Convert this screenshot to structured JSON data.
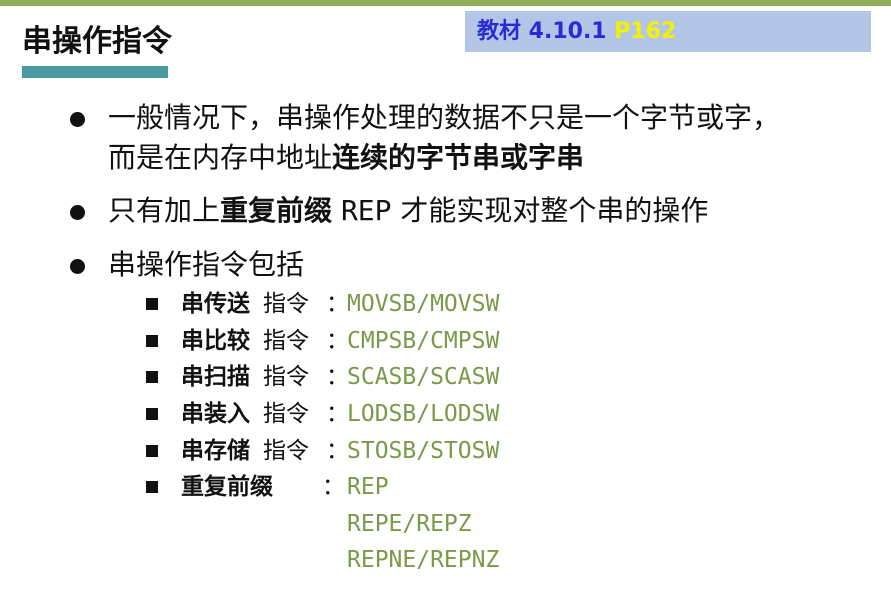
{
  "slide": {
    "title": "串操作指令",
    "reference": {
      "label": "教材 4.10.1",
      "page": "P162"
    }
  },
  "bullets": [
    {
      "line1": "一般情况下，串操作处理的数据不只是一个字节或字，",
      "line2_prefix": "而是在内存中地址",
      "line2_bold": "连续的字节串或字串"
    },
    {
      "prefix": "只有加上",
      "bold": "重复前缀",
      "code": "REP",
      "suffix": "才能实现对整个串的操作"
    },
    {
      "text": "串操作指令包括"
    }
  ],
  "instructions": [
    {
      "name": "串传送",
      "suffix": "指令",
      "colon": "：",
      "code": "MOVSB/MOVSW"
    },
    {
      "name": "串比较",
      "suffix": "指令",
      "colon": "：",
      "code": "CMPSB/CMPSW"
    },
    {
      "name": "串扫描",
      "suffix": "指令",
      "colon": "：",
      "code": "SCASB/SCASW"
    },
    {
      "name": "串装入",
      "suffix": "指令",
      "colon": "：",
      "code": "LODSB/LODSW"
    },
    {
      "name": "串存储",
      "suffix": "指令",
      "colon": "：",
      "code": "STOSB/STOSW"
    }
  ],
  "prefix_item": {
    "name": "重复前缀",
    "colon": "：",
    "codes": [
      "REP",
      "REPE/REPZ",
      "REPNE/REPNZ"
    ]
  },
  "colors": {
    "top_bar": "#8fae5a",
    "title_underline": "#4a9aa2",
    "ref_box_bg": "#b4c6e7",
    "ref_label": "#2b2bd4",
    "ref_page": "#f2f200",
    "code": "#7a9a4a"
  }
}
